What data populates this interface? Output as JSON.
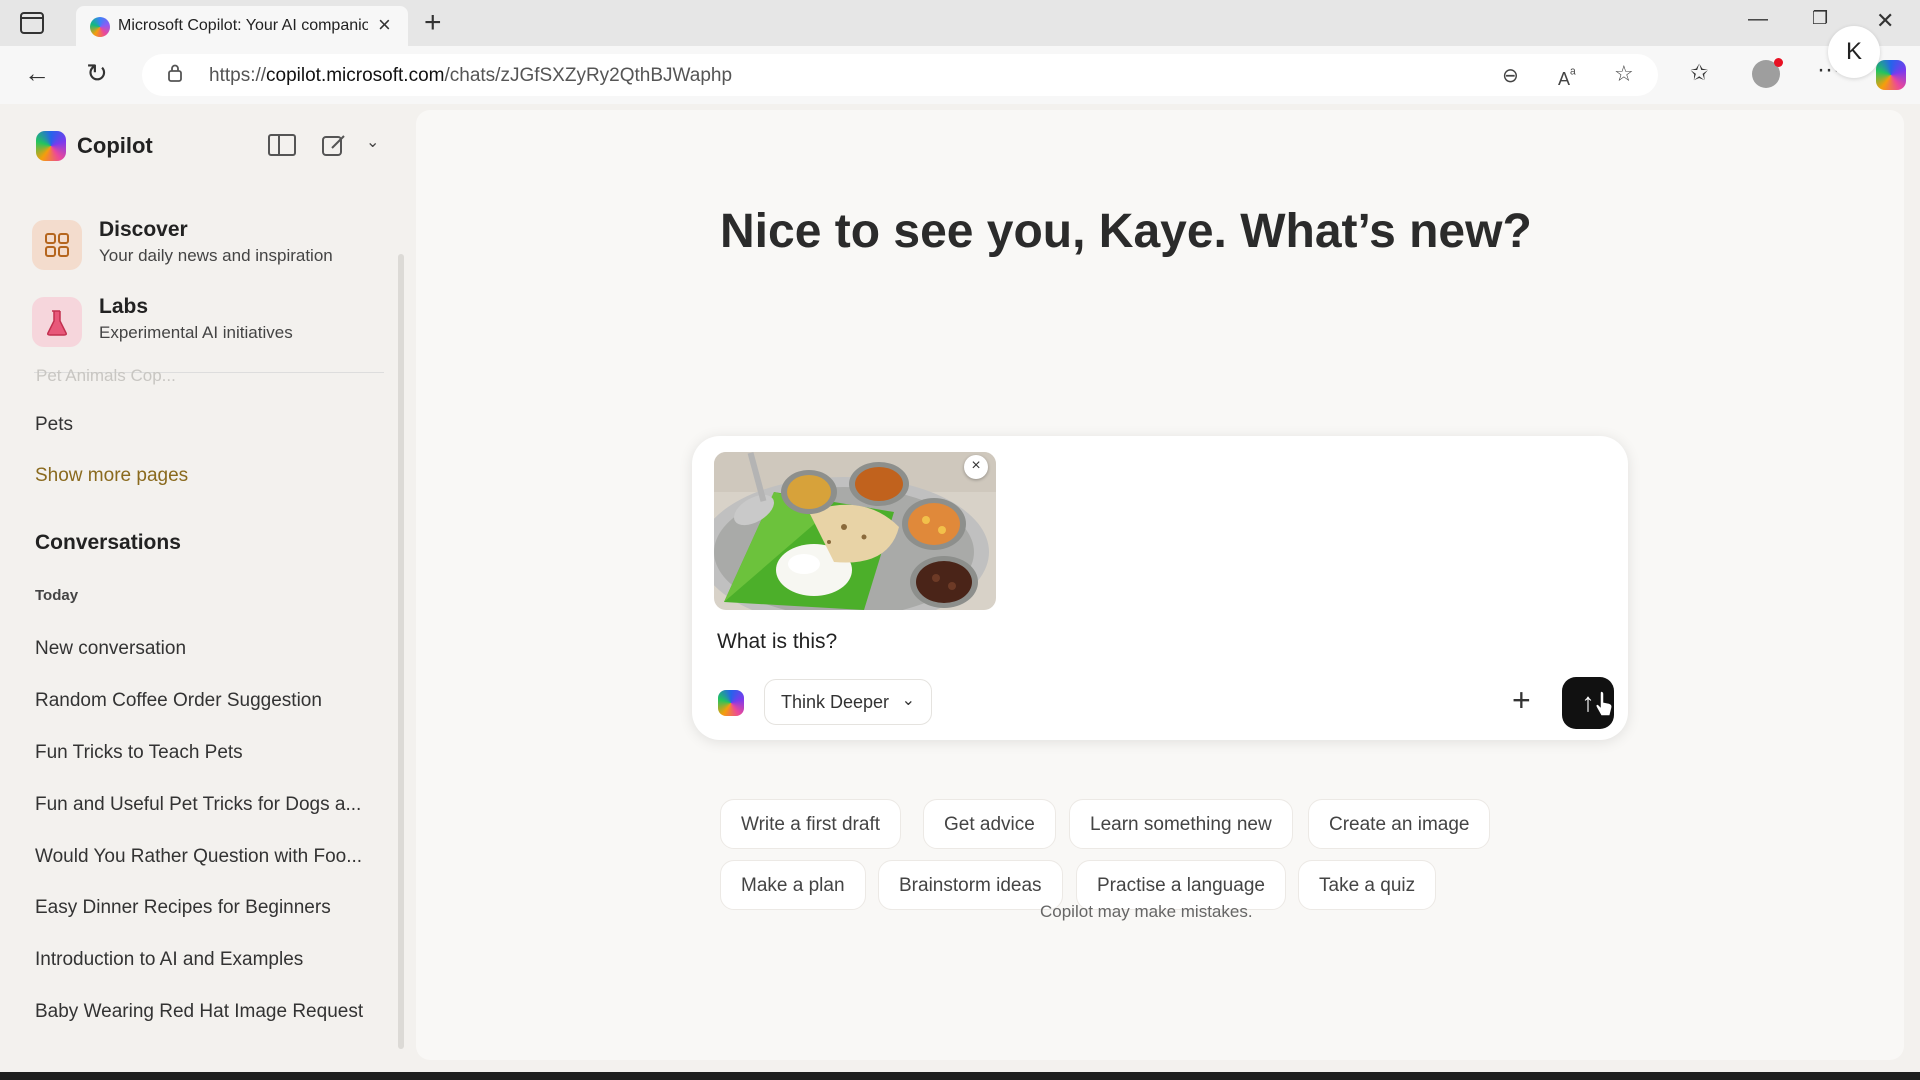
{
  "browser": {
    "tab_title": "Microsoft Copilot: Your AI companion",
    "url_prefix": "https://",
    "url_host": "copilot.microsoft.com",
    "url_path": "/chats/zJGfSXZyRy2QthBJWaphp"
  },
  "sidebar": {
    "brand": "Copilot",
    "features": [
      {
        "title": "Discover",
        "subtitle": "Your daily news and inspiration"
      },
      {
        "title": "Labs",
        "subtitle": "Experimental AI initiatives"
      }
    ],
    "faded_item": "Pet Animals Cop...",
    "pages_item": "Pets",
    "show_more": "Show more pages",
    "conversations_heading": "Conversations",
    "today_label": "Today",
    "conversations": [
      "New conversation",
      "Random Coffee Order Suggestion",
      "Fun Tricks to Teach Pets",
      "Fun and Useful Pet Tricks for Dogs a...",
      "Would You Rather Question with Foo...",
      "Easy Dinner Recipes for Beginners",
      "Introduction to AI and Examples",
      "Baby Wearing Red Hat Image Request"
    ]
  },
  "main": {
    "avatar_initial": "K",
    "greeting": "Nice to see you, Kaye. What’s new?",
    "composer": {
      "prompt": "What is this?",
      "mode": "Think Deeper",
      "attachment_alt": "Thali meal with rice, roti and curries on banana leaf"
    },
    "chips_row1": [
      "Write a first draft",
      "Get advice",
      "Learn something new",
      "Create an image"
    ],
    "chips_row2": [
      "Make a plan",
      "Brainstorm ideas",
      "Practise a language",
      "Take a quiz"
    ],
    "disclaimer": "Copilot may make mistakes."
  },
  "icons": {
    "discover": "grid-icon",
    "labs": "flask-icon",
    "send": "arrow-up-icon"
  },
  "colors": {
    "accent_link": "#8a6a1e",
    "send_button": "#111111",
    "sidebar_bg": "#f3f1ee"
  }
}
